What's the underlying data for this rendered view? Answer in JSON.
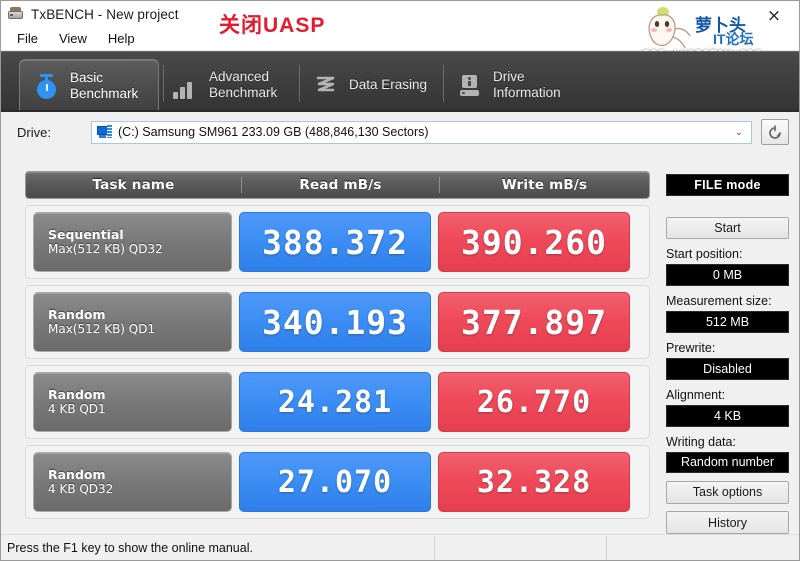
{
  "window": {
    "title": "TxBENCH - New project",
    "title_icon": "drive-icon",
    "close_label": "×"
  },
  "annotation": {
    "text": "关闭UASP",
    "color": "#e8192c"
  },
  "watermark": {
    "brand_cn": "萝卜头",
    "brand_sub": "IT论坛",
    "url": "BBS.LUOBOTOU.ORG"
  },
  "menubar": {
    "items": [
      {
        "label": "File"
      },
      {
        "label": "View"
      },
      {
        "label": "Help"
      }
    ]
  },
  "tabs": [
    {
      "label": "Basic\nBenchmark",
      "icon": "stopwatch-icon",
      "active": true
    },
    {
      "label": "Advanced\nBenchmark",
      "icon": "bar-chart-icon",
      "active": false
    },
    {
      "label": "Data Erasing",
      "icon": "erase-icon",
      "active": false
    },
    {
      "label": "Drive\nInformation",
      "icon": "drive-info-icon",
      "active": false
    }
  ],
  "drive": {
    "label": "Drive:",
    "selected": "(C:) Samsung SM961  233.09 GB (488,846,130 Sectors)",
    "icon": "computer-drive-icon",
    "dropdown_arrow": "⌄",
    "refresh_icon": "refresh-icon"
  },
  "results": {
    "columns": [
      "Task name",
      "Read mB/s",
      "Write mB/s"
    ],
    "rows": [
      {
        "task_line1": "Sequential",
        "task_line2": "Max(512 KB) QD32",
        "read": "388.372",
        "write": "390.260"
      },
      {
        "task_line1": "Random",
        "task_line2": "Max(512 KB) QD1",
        "read": "340.193",
        "write": "377.897"
      },
      {
        "task_line1": "Random",
        "task_line2": "4 KB QD1",
        "read": "24.281",
        "write": "26.770"
      },
      {
        "task_line1": "Random",
        "task_line2": "4 KB QD32",
        "read": "27.070",
        "write": "32.328"
      }
    ]
  },
  "sidebar": {
    "mode_value": "FILE mode",
    "start_button": "Start",
    "start_position_label": "Start position:",
    "start_position_value": "0 MB",
    "measurement_size_label": "Measurement size:",
    "measurement_size_value": "512 MB",
    "prewrite_label": "Prewrite:",
    "prewrite_value": "Disabled",
    "alignment_label": "Alignment:",
    "alignment_value": "4 KB",
    "writing_data_label": "Writing data:",
    "writing_data_value": "Random number",
    "task_options_button": "Task options",
    "history_button": "History"
  },
  "statusbar": {
    "message": "Press the F1 key to show the online manual."
  },
  "colors": {
    "read_accent": "#3d8ef5",
    "write_accent": "#ef4a5a",
    "tabstrip_bg": "#3d3d3d",
    "annotation_red": "#e8192c"
  }
}
